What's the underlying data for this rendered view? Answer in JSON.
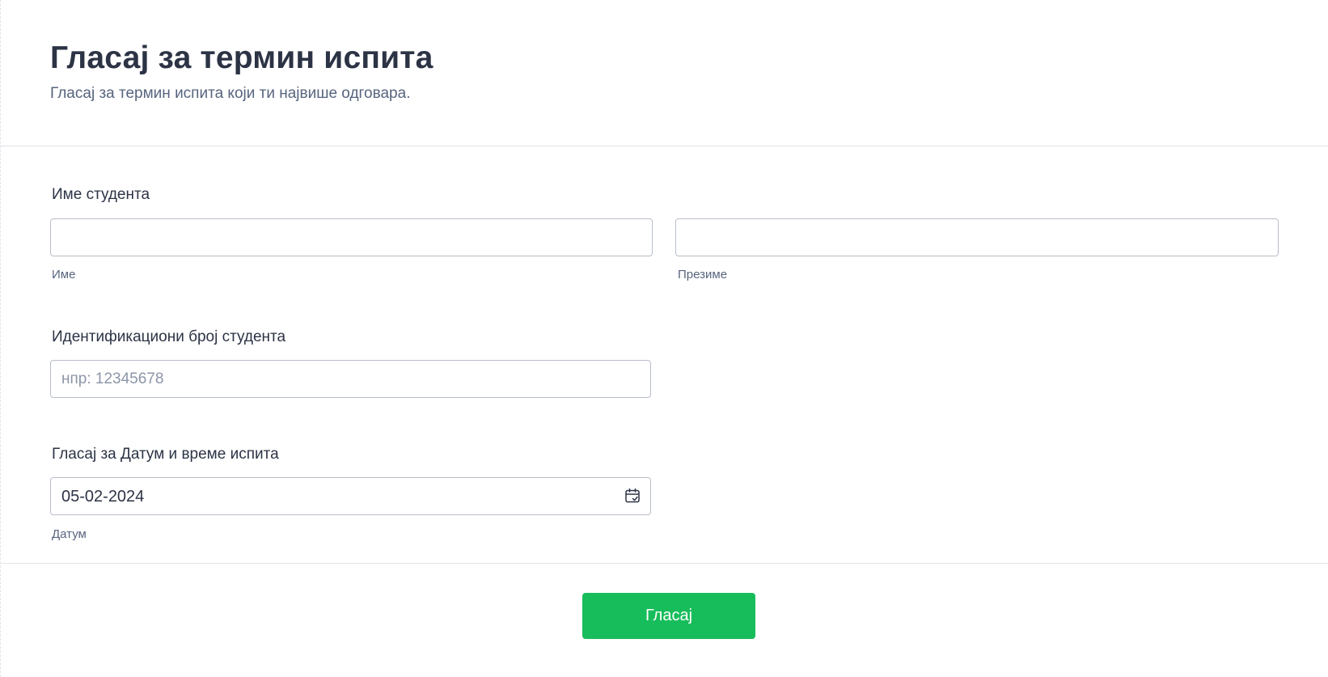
{
  "form": {
    "title": "Гласај за термин испита",
    "subtitle": "Гласај за термин испита који ти највише одговара."
  },
  "student_name": {
    "label": "Име студента",
    "first_name_value": "",
    "first_name_sublabel": "Име",
    "last_name_value": "",
    "last_name_sublabel": "Презиме"
  },
  "student_id": {
    "label": "Идентификациони број студента",
    "placeholder": "нпр: 12345678",
    "value": ""
  },
  "exam_date": {
    "label": "Гласај за Датум и време испита",
    "value": "05-02-2024",
    "sublabel": "Датум",
    "icon": "calendar-check-icon"
  },
  "submit": {
    "label": "Гласај",
    "color": "#18bd5b"
  }
}
